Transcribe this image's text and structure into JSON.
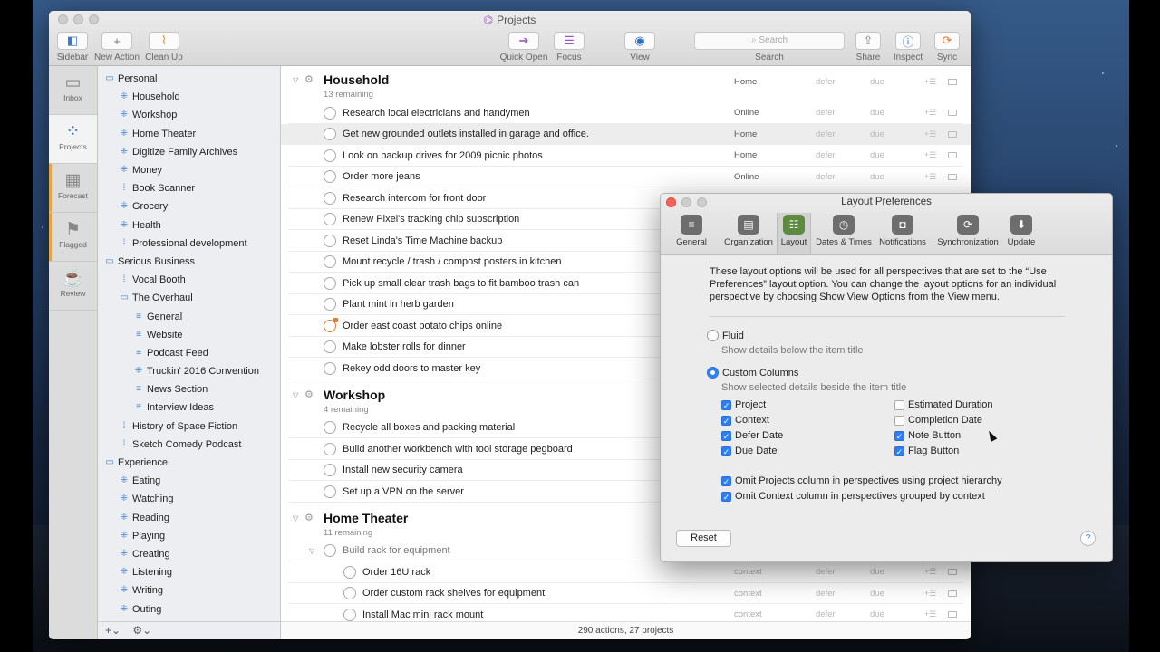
{
  "window": {
    "title": "Projects"
  },
  "toolbar": {
    "sidebar": "Sidebar",
    "new_action": "New Action",
    "clean_up": "Clean Up",
    "quick_open": "Quick Open",
    "focus": "Focus",
    "view": "View",
    "search_placeholder": "Search",
    "search_label": "Search",
    "share": "Share",
    "inspect": "Inspect",
    "sync": "Sync"
  },
  "rail": [
    {
      "label": "Inbox",
      "icon": "inbox-icon"
    },
    {
      "label": "Projects",
      "icon": "projects-icon"
    },
    {
      "label": "Forecast",
      "icon": "forecast-icon"
    },
    {
      "label": "Flagged",
      "icon": "flag-icon"
    },
    {
      "label": "Review",
      "icon": "review-icon"
    }
  ],
  "sidebar": {
    "items": [
      {
        "label": "Personal",
        "level": 0,
        "type": "folder"
      },
      {
        "label": "Household",
        "level": 1,
        "type": "parallel"
      },
      {
        "label": "Workshop",
        "level": 1,
        "type": "parallel"
      },
      {
        "label": "Home Theater",
        "level": 1,
        "type": "parallel"
      },
      {
        "label": "Digitize Family Archives",
        "level": 1,
        "type": "parallel"
      },
      {
        "label": "Money",
        "level": 1,
        "type": "parallel"
      },
      {
        "label": "Book Scanner",
        "level": 1,
        "type": "sequential"
      },
      {
        "label": "Grocery",
        "level": 1,
        "type": "parallel"
      },
      {
        "label": "Health",
        "level": 1,
        "type": "parallel"
      },
      {
        "label": "Professional development",
        "level": 1,
        "type": "sequential"
      },
      {
        "label": "Serious Business",
        "level": 0,
        "type": "folder"
      },
      {
        "label": "Vocal Booth",
        "level": 1,
        "type": "sequential"
      },
      {
        "label": "The Overhaul",
        "level": 1,
        "type": "folder"
      },
      {
        "label": "General",
        "level": 2,
        "type": "list"
      },
      {
        "label": "Website",
        "level": 2,
        "type": "list"
      },
      {
        "label": "Podcast Feed",
        "level": 2,
        "type": "list"
      },
      {
        "label": "Truckin' 2016 Convention",
        "level": 2,
        "type": "parallel"
      },
      {
        "label": "News Section",
        "level": 2,
        "type": "list"
      },
      {
        "label": "Interview Ideas",
        "level": 2,
        "type": "list"
      },
      {
        "label": "History of Space Fiction",
        "level": 1,
        "type": "sequential"
      },
      {
        "label": "Sketch Comedy Podcast",
        "level": 1,
        "type": "sequential"
      },
      {
        "label": "Experience",
        "level": 0,
        "type": "folder"
      },
      {
        "label": "Eating",
        "level": 1,
        "type": "parallel"
      },
      {
        "label": "Watching",
        "level": 1,
        "type": "parallel"
      },
      {
        "label": "Reading",
        "level": 1,
        "type": "parallel"
      },
      {
        "label": "Playing",
        "level": 1,
        "type": "parallel"
      },
      {
        "label": "Creating",
        "level": 1,
        "type": "parallel"
      },
      {
        "label": "Listening",
        "level": 1,
        "type": "parallel"
      },
      {
        "label": "Writing",
        "level": 1,
        "type": "parallel"
      },
      {
        "label": "Outing",
        "level": 1,
        "type": "parallel"
      }
    ],
    "footer_add": "+⌄",
    "footer_gear": "⚙⌄"
  },
  "columns": {
    "defer": "defer",
    "due": "due"
  },
  "projects": [
    {
      "title": "Household",
      "remaining": "13 remaining",
      "context": "Home",
      "actions": [
        {
          "title": "Research local electricians and handymen",
          "context": "Online"
        },
        {
          "title": "Get new grounded outlets installed in garage and office.",
          "context": "Home",
          "selected": true
        },
        {
          "title": "Look on backup drives for 2009 picnic photos",
          "context": "Home"
        },
        {
          "title": "Order more jeans",
          "context": "Online"
        },
        {
          "title": "Research intercom for front door",
          "context": ""
        },
        {
          "title": "Renew Pixel's tracking chip subscription",
          "context": ""
        },
        {
          "title": "Reset Linda's Time Machine backup",
          "context": ""
        },
        {
          "title": "Mount recycle / trash / compost posters in kitchen",
          "context": ""
        },
        {
          "title": "Pick up small clear trash bags to fit bamboo trash can",
          "context": ""
        },
        {
          "title": "Plant mint in herb garden",
          "context": ""
        },
        {
          "title": "Order east coast potato chips online",
          "context": "",
          "flagged": true
        },
        {
          "title": "Make lobster rolls for dinner",
          "context": ""
        },
        {
          "title": "Rekey odd doors to master key",
          "context": ""
        }
      ]
    },
    {
      "title": "Workshop",
      "remaining": "4 remaining",
      "context": "",
      "actions": [
        {
          "title": "Recycle all boxes and packing material",
          "context": ""
        },
        {
          "title": "Build another workbench with tool storage pegboard",
          "context": ""
        },
        {
          "title": "Install new security camera",
          "context": ""
        },
        {
          "title": "Set up a VPN on the server",
          "context": ""
        }
      ]
    },
    {
      "title": "Home Theater",
      "remaining": "11 remaining",
      "context": "",
      "actions": [
        {
          "title": "Build rack for equipment",
          "context": "",
          "group": true
        },
        {
          "title": "Order 16U rack",
          "context": "context",
          "child": true
        },
        {
          "title": "Order custom rack shelves for equipment",
          "context": "context",
          "child": true
        },
        {
          "title": "Install Mac mini rack mount",
          "context": "context",
          "child": true
        }
      ]
    }
  ],
  "status": "290 actions, 27 projects",
  "prefs": {
    "title": "Layout Preferences",
    "tabs": [
      "General",
      "Organization",
      "Layout",
      "Dates & Times",
      "Notifications",
      "Synchronization",
      "Update"
    ],
    "active_tab": "Layout",
    "intro": "These layout options will be used for all perspectives that are set to the “Use Preferences” layout option. You can change the layout options for an individual perspective by choosing Show View Options from the View menu.",
    "fluid_label": "Fluid",
    "fluid_desc": "Show details below the item title",
    "custom_label": "Custom Columns",
    "custom_desc": "Show selected details beside the item title",
    "selected_mode": "Custom Columns",
    "columns_left": [
      {
        "label": "Project",
        "checked": true
      },
      {
        "label": "Context",
        "checked": true
      },
      {
        "label": "Defer Date",
        "checked": true
      },
      {
        "label": "Due Date",
        "checked": true
      }
    ],
    "columns_right": [
      {
        "label": "Estimated Duration",
        "checked": false
      },
      {
        "label": "Completion Date",
        "checked": false
      },
      {
        "label": "Note Button",
        "checked": true
      },
      {
        "label": "Flag Button",
        "checked": true
      }
    ],
    "omit_projects": {
      "label": "Omit Projects column in perspectives using project hierarchy",
      "checked": true
    },
    "omit_context": {
      "label": "Omit Context column in perspectives grouped by context",
      "checked": true
    },
    "reset": "Reset",
    "help": "?"
  }
}
